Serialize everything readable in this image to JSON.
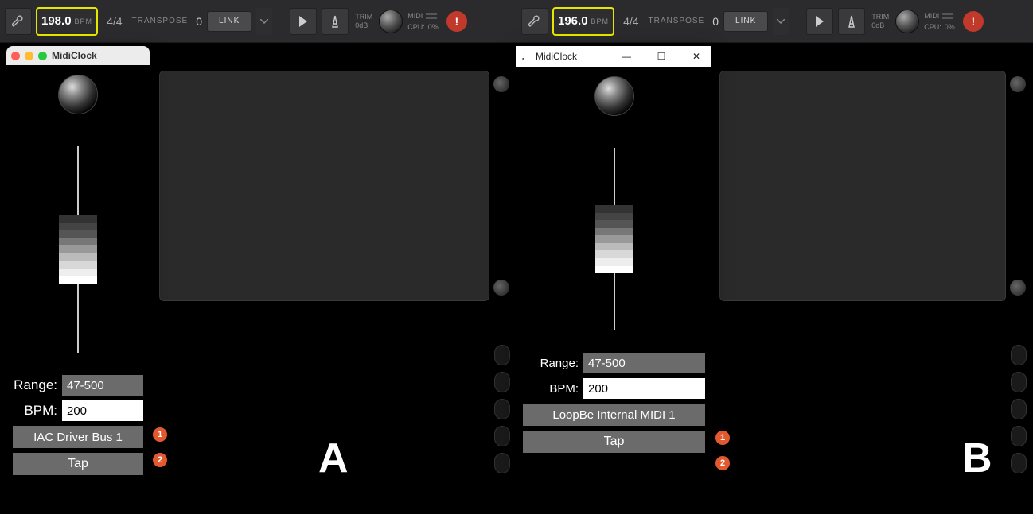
{
  "panelA": {
    "letter": "A",
    "toolbar": {
      "bpm_value": "198.0",
      "bpm_unit": "BPM",
      "timesig": "4/4",
      "transpose_label": "TRANSPOSE",
      "transpose_value": "0",
      "link_label": "LINK",
      "trim_label": "TRIM",
      "trim_value": "0dB",
      "midi_label": "MIDI",
      "cpu_label": "CPU:",
      "cpu_value": "0%"
    },
    "midiclock": {
      "title": "MidiClock",
      "range_label": "Range:",
      "range_value": "47-500",
      "bpm_label": "BPM:",
      "bpm_value": "200",
      "device": "IAC Driver Bus 1",
      "tap_label": "Tap",
      "callouts": {
        "bpm": "1",
        "device": "2"
      }
    }
  },
  "panelB": {
    "letter": "B",
    "toolbar": {
      "bpm_value": "196.0",
      "bpm_unit": "BPM",
      "timesig": "4/4",
      "transpose_label": "TRANSPOSE",
      "transpose_value": "0",
      "link_label": "LINK",
      "trim_label": "TRIM",
      "trim_value": "0dB",
      "midi_label": "MIDI",
      "cpu_label": "CPU:",
      "cpu_value": "0%"
    },
    "midiclock": {
      "title": "MidiClock",
      "range_label": "Range:",
      "range_value": "47-500",
      "bpm_label": "BPM:",
      "bpm_value": "200",
      "device": "LoopBe Internal MIDI 1",
      "tap_label": "Tap",
      "callouts": {
        "bpm": "1",
        "device": "2"
      }
    }
  }
}
